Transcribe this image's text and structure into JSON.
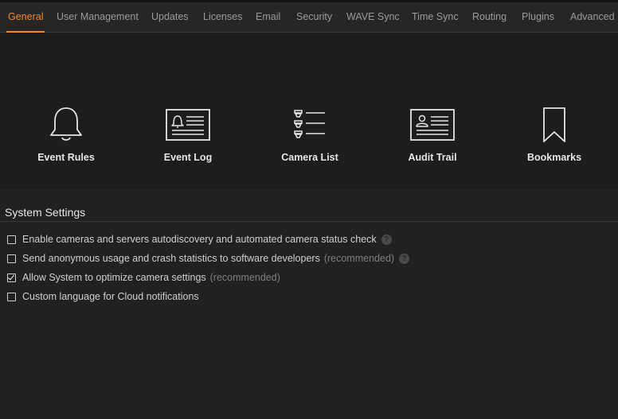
{
  "tabs": [
    {
      "label": "General",
      "active": true
    },
    {
      "label": "User Management"
    },
    {
      "label": "Updates"
    },
    {
      "label": "Licenses"
    },
    {
      "label": "Email"
    },
    {
      "label": "Security"
    },
    {
      "label": "WAVE Sync"
    },
    {
      "label": "Time Sync"
    },
    {
      "label": "Routing"
    },
    {
      "label": "Plugins"
    },
    {
      "label": "Advanced"
    }
  ],
  "tools": [
    {
      "label": "Event Rules",
      "icon": "bell-icon"
    },
    {
      "label": "Event Log",
      "icon": "event-log-icon"
    },
    {
      "label": "Camera List",
      "icon": "camera-list-icon"
    },
    {
      "label": "Audit Trail",
      "icon": "audit-trail-icon"
    },
    {
      "label": "Bookmarks",
      "icon": "bookmark-icon"
    }
  ],
  "system_settings": {
    "title": "System Settings",
    "options": [
      {
        "label": "Enable cameras and servers autodiscovery and automated camera status check",
        "checked": false,
        "help": "?"
      },
      {
        "label": "Send anonymous usage and crash statistics to software developers",
        "note": "(recommended)",
        "checked": false,
        "help": "?"
      },
      {
        "label": "Allow System to optimize camera settings",
        "note": "(recommended)",
        "checked": true
      },
      {
        "label": "Custom language for Cloud notifications",
        "checked": false
      }
    ]
  },
  "colors": {
    "accent": "#f0862a",
    "background": "#212121",
    "panel": "#1d1d1d"
  }
}
